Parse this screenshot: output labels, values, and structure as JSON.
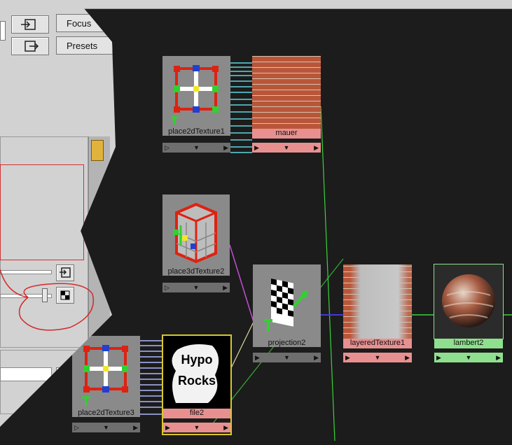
{
  "editor": {
    "buttons": {
      "focus": "Focus",
      "presets": "Presets"
    }
  },
  "nodes": {
    "place2dTexture1": {
      "label": "place2dTexture1"
    },
    "mauer": {
      "label": "mauer"
    },
    "place3dTexture2": {
      "label": "place3dTexture2"
    },
    "projection2": {
      "label": "projection2"
    },
    "layeredTexture1": {
      "label": "layeredTexture1"
    },
    "lambert2": {
      "label": "lambert2"
    },
    "place2dTexture3": {
      "label": "place2dTexture3"
    },
    "file2": {
      "label": "file2",
      "image_text": [
        "Hypo",
        "Rocks"
      ]
    }
  },
  "colors": {
    "canvas": "#1c1c1c",
    "node_grey": "#8a8a8a",
    "node_pink": "#e89090",
    "node_green": "#8ee08e",
    "selected": "#d8c82a",
    "connection_cyan": "#5fd6e0",
    "connection_green": "#3ad33a",
    "connection_purple": "#c050d0",
    "annotation_red": "#d42a2a"
  }
}
